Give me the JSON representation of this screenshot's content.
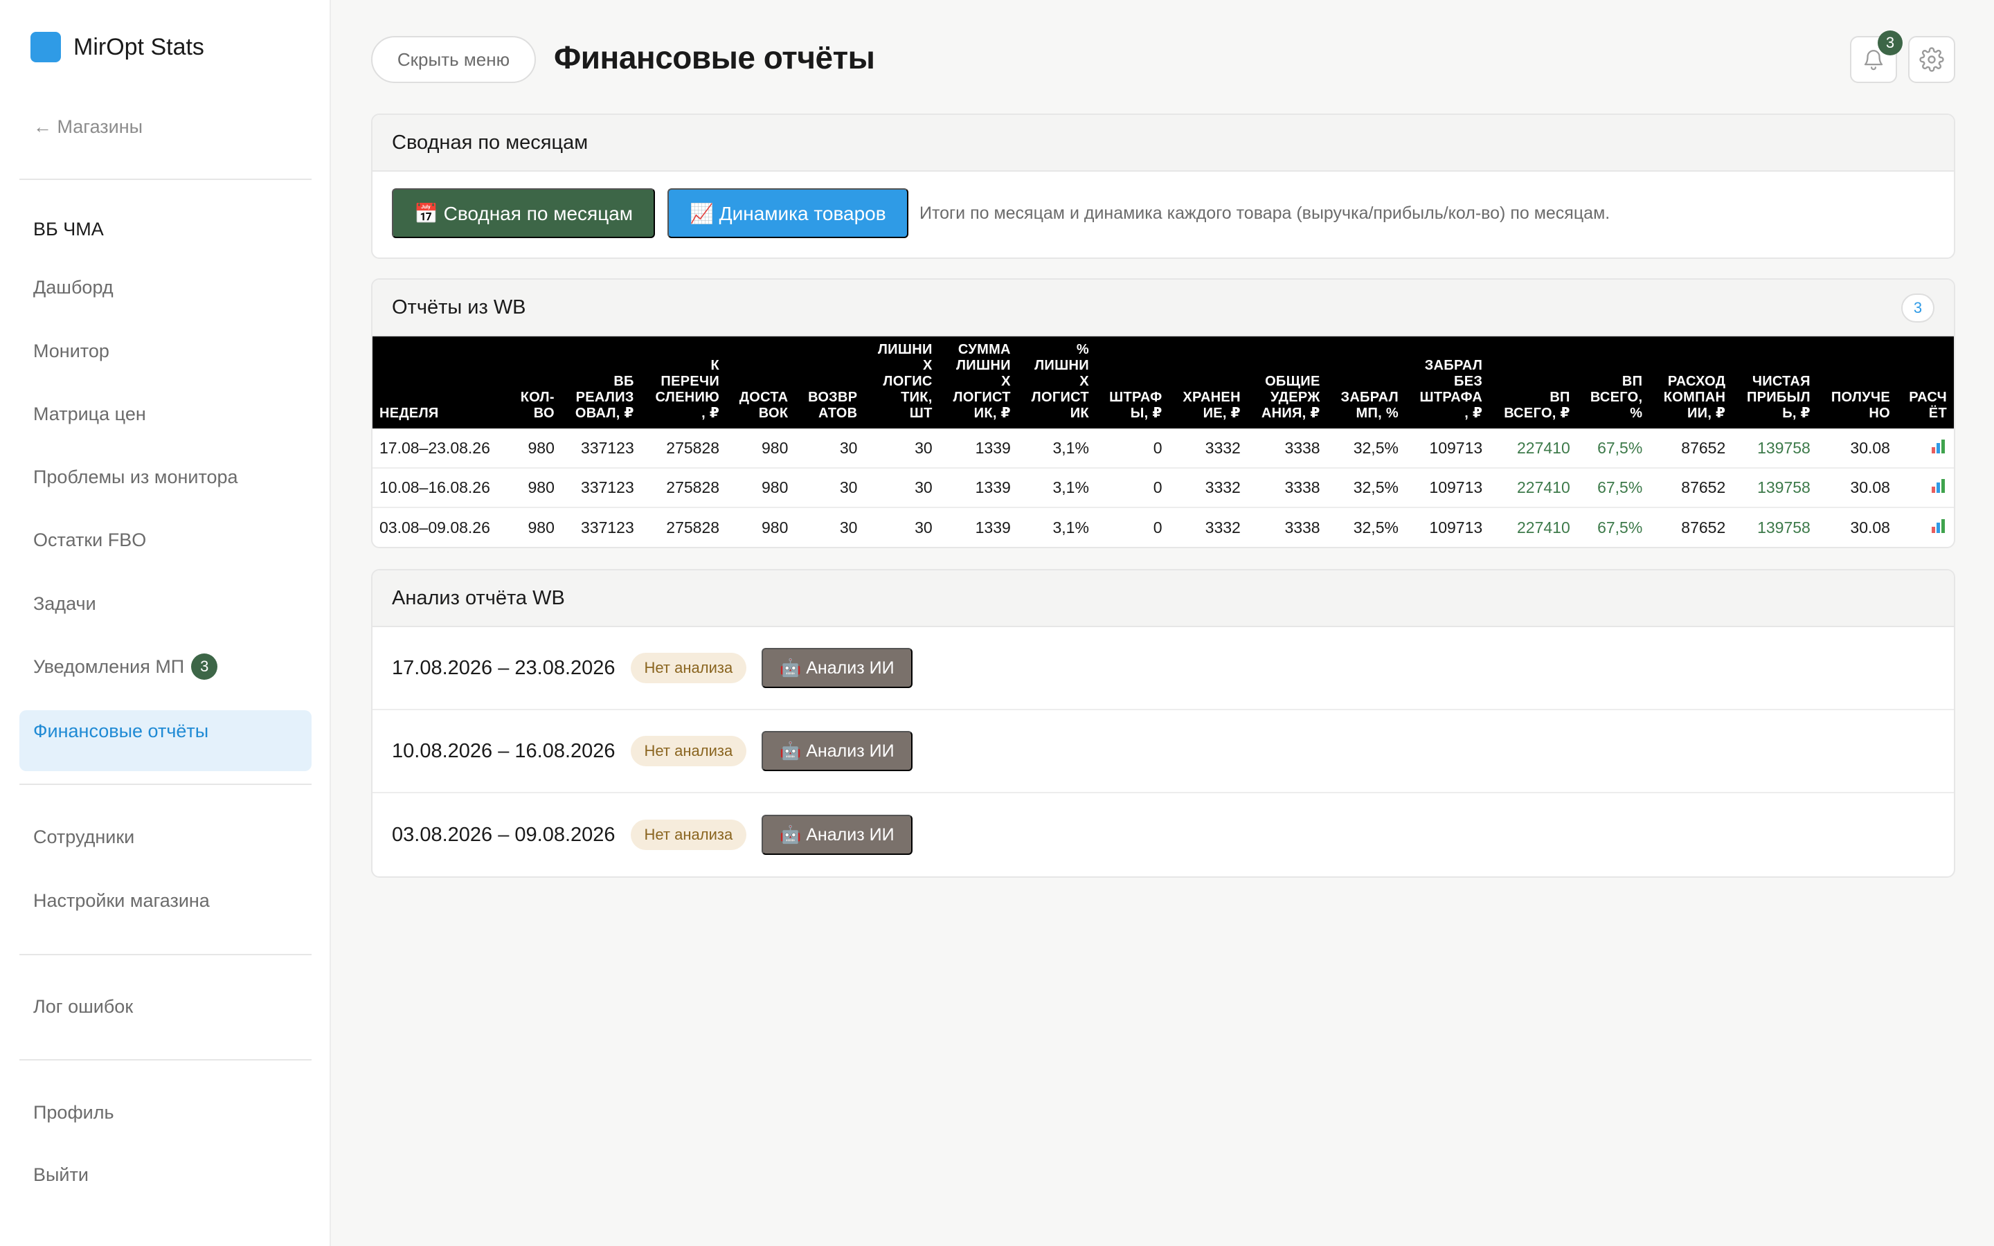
{
  "app": {
    "name": "MirOpt Stats",
    "accent": "#2f9be6"
  },
  "sidebar": {
    "back_link": "← Магазины",
    "store_name": "ВБ ЧМА",
    "items": [
      {
        "label": "Дашборд"
      },
      {
        "label": "Монитор"
      },
      {
        "label": "Матрица цен"
      },
      {
        "label": "Проблемы из монитора"
      },
      {
        "label": "Остатки FBO"
      },
      {
        "label": "Задачи"
      },
      {
        "label": "Уведомления МП",
        "badge": "3"
      },
      {
        "label": "Финансовые отчёты",
        "active": true
      }
    ],
    "secondary": [
      {
        "label": "Сотрудники"
      },
      {
        "label": "Настройки магазина"
      }
    ],
    "error_log": "Лог ошибок",
    "profile": "Профиль",
    "logout": "Выйти"
  },
  "header": {
    "hide_menu": "Скрыть меню",
    "title": "Финансовые отчёты",
    "notifications_count": "3",
    "icons": [
      "bell-icon",
      "gear-icon"
    ]
  },
  "summary": {
    "title": "Сводная по месяцам",
    "btn_monthly": "📅 Сводная по месяцам",
    "btn_dynamics": "📈 Динамика товаров",
    "note": "Итоги по месяцам и динамика каждого товара (выручка/прибыль/кол-во) по месяцам."
  },
  "reports": {
    "title": "Отчёты из WB",
    "count": "3",
    "columns": [
      "НЕДЕЛЯ",
      "КОЛ-\nВО",
      "ВБ\nРЕАЛИЗ\nОВАЛ, ₽",
      "К\nПЕРЕЧИ\nСЛЕНИЮ\n, ₽",
      "ДОСТА\nВОК",
      "ВОЗВР\nАТОВ",
      "ЛИШНИ\nХ\nЛОГИС\nТИК,\nШТ",
      "СУММА\nЛИШНИ\nХ\nЛОГИСТ\nИК, ₽",
      "%\nЛИШНИ\nХ\nЛОГИСТ\nИК",
      "ШТРАФ\nЫ, ₽",
      "ХРАНЕН\nИЕ, ₽",
      "ОБЩИЕ\nУДЕРЖ\nАНИЯ, ₽",
      "ЗАБРАЛ\nМП, %",
      "ЗАБРАЛ\nБЕЗ\nШТРАФА\n, ₽",
      "ВП\nВСЕГО, ₽",
      "ВП\nВСЕГО,\n%",
      "РАСХОД\nКОМПАН\nИИ, ₽",
      "ЧИСТАЯ\nПРИБЫЛ\nЬ, ₽",
      "ПОЛУЧЕ\nНО",
      "РАСЧ\nЁТ"
    ],
    "rows": [
      [
        "17.08–23.08.26",
        "980",
        "337123",
        "275828",
        "980",
        "30",
        "30",
        "1339",
        "3,1%",
        "0",
        "3332",
        "3338",
        "32,5%",
        "109713",
        "227410",
        "67,5%",
        "87652",
        "139758",
        "30.08"
      ],
      [
        "10.08–16.08.26",
        "980",
        "337123",
        "275828",
        "980",
        "30",
        "30",
        "1339",
        "3,1%",
        "0",
        "3332",
        "3338",
        "32,5%",
        "109713",
        "227410",
        "67,5%",
        "87652",
        "139758",
        "30.08"
      ],
      [
        "03.08–09.08.26",
        "980",
        "337123",
        "275828",
        "980",
        "30",
        "30",
        "1339",
        "3,1%",
        "0",
        "3332",
        "3338",
        "32,5%",
        "109713",
        "227410",
        "67,5%",
        "87652",
        "139758",
        "30.08"
      ]
    ],
    "positive_color": "#3d7a4a"
  },
  "analysis": {
    "title": "Анализ отчёта WB",
    "rows": [
      {
        "period": "17.08.2026 – 23.08.2026",
        "status": "Нет анализа",
        "button": "🤖 Анализ ИИ"
      },
      {
        "period": "10.08.2026 – 16.08.2026",
        "status": "Нет анализа",
        "button": "🤖 Анализ ИИ"
      },
      {
        "period": "03.08.2026 – 09.08.2026",
        "status": "Нет анализа",
        "button": "🤖 Анализ ИИ"
      }
    ]
  }
}
